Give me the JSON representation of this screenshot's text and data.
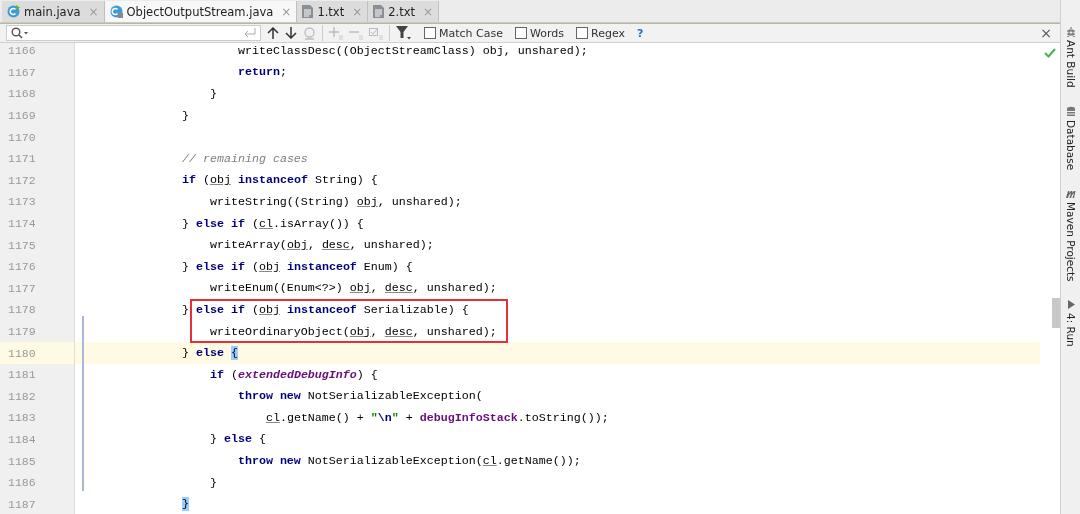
{
  "tabs": [
    {
      "label": "main.java",
      "kind": "java",
      "selected": false,
      "close": "×"
    },
    {
      "label": "ObjectOutputStream.java",
      "kind": "javalock",
      "selected": true,
      "close": "×"
    },
    {
      "label": "1.txt",
      "kind": "text",
      "selected": false,
      "close": "×"
    },
    {
      "label": "2.txt",
      "kind": "text",
      "selected": false,
      "close": "×"
    }
  ],
  "find_bar": {
    "options": [
      {
        "label": "Match Case",
        "checked": false
      },
      {
        "label": "Words",
        "checked": false
      },
      {
        "label": "Regex",
        "checked": false
      }
    ],
    "help": "?",
    "close": "×"
  },
  "editor": {
    "lines": [
      {
        "number": "1166",
        "segments": [
          {
            "text": "                    writeClassDesc((ObjectStreamClass) obj, unshared);",
            "kind": "plain"
          }
        ]
      },
      {
        "number": "1167",
        "segments": [
          {
            "text": "                    return",
            "kind": "kw"
          },
          {
            "text": ";",
            "kind": "plain"
          }
        ]
      },
      {
        "number": "1168",
        "segments": [
          {
            "text": "                }",
            "kind": "plain"
          }
        ]
      },
      {
        "number": "1169",
        "segments": [
          {
            "text": "            }",
            "kind": "plain"
          }
        ]
      },
      {
        "number": "1170"
      },
      {
        "number": "1171",
        "segments": [
          {
            "text": "            // remaining cases",
            "kind": "comment"
          }
        ]
      },
      {
        "number": "1172",
        "segments": [
          {
            "text": "            if",
            "kind": "kw"
          },
          {
            "text": " (",
            "kind": "plain"
          },
          {
            "text": "obj",
            "kind": "var"
          },
          {
            "text": " instanceof",
            "kind": "kw"
          },
          {
            "text": " String) {",
            "kind": "plain"
          }
        ]
      },
      {
        "number": "1173",
        "segments": [
          {
            "text": "                writeString((String) ",
            "kind": "plain"
          },
          {
            "text": "obj",
            "kind": "var"
          },
          {
            "text": ", unshared);",
            "kind": "plain"
          }
        ]
      },
      {
        "number": "1174",
        "segments": [
          {
            "text": "            } ",
            "kind": "plain"
          },
          {
            "text": "else if",
            "kind": "kw"
          },
          {
            "text": " (",
            "kind": "plain"
          },
          {
            "text": "cl",
            "kind": "var"
          },
          {
            "text": ".isArray()) {",
            "kind": "plain"
          }
        ]
      },
      {
        "number": "1175",
        "segments": [
          {
            "text": "                writeArray(",
            "kind": "plain"
          },
          {
            "text": "obj",
            "kind": "var"
          },
          {
            "text": ", ",
            "kind": "plain"
          },
          {
            "text": "desc",
            "kind": "var"
          },
          {
            "text": ", unshared);",
            "kind": "plain"
          }
        ]
      },
      {
        "number": "1176",
        "segments": [
          {
            "text": "            } ",
            "kind": "plain"
          },
          {
            "text": "else if",
            "kind": "kw"
          },
          {
            "text": " (",
            "kind": "plain"
          },
          {
            "text": "obj",
            "kind": "var"
          },
          {
            "text": " instanceof",
            "kind": "kw"
          },
          {
            "text": " Enum) {",
            "kind": "plain"
          }
        ]
      },
      {
        "number": "1177",
        "segments": [
          {
            "text": "                writeEnum((Enum<?>) ",
            "kind": "plain"
          },
          {
            "text": "obj",
            "kind": "var"
          },
          {
            "text": ", ",
            "kind": "plain"
          },
          {
            "text": "desc",
            "kind": "var"
          },
          {
            "text": ", unshared);",
            "kind": "plain"
          }
        ]
      },
      {
        "number": "1178",
        "segments": [
          {
            "text": "            } ",
            "kind": "plain"
          },
          {
            "text": "else if",
            "kind": "kw"
          },
          {
            "text": " (",
            "kind": "plain"
          },
          {
            "text": "obj",
            "kind": "var"
          },
          {
            "text": " instanceof",
            "kind": "kw"
          },
          {
            "text": " Serializable) {",
            "kind": "plain"
          }
        ]
      },
      {
        "number": "1179",
        "segments": [
          {
            "text": "                writeOrdinaryObject(",
            "kind": "plain"
          },
          {
            "text": "obj",
            "kind": "var"
          },
          {
            "text": ", ",
            "kind": "plain"
          },
          {
            "text": "desc",
            "kind": "var"
          },
          {
            "text": ", unshared);",
            "kind": "plain"
          }
        ]
      },
      {
        "number": "1180",
        "current": true,
        "segments": [
          {
            "text": "            } ",
            "kind": "plain"
          },
          {
            "text": "else ",
            "kind": "kw"
          },
          {
            "text": "{",
            "kind": "brace"
          }
        ]
      },
      {
        "number": "1181",
        "segments": [
          {
            "text": "                if",
            "kind": "kw"
          },
          {
            "text": " (",
            "kind": "plain"
          },
          {
            "text": "extendedDebugInfo",
            "kind": "static"
          },
          {
            "text": ") {",
            "kind": "plain"
          }
        ]
      },
      {
        "number": "1182",
        "segments": [
          {
            "text": "                    throw new",
            "kind": "kw"
          },
          {
            "text": " NotSerializableException(",
            "kind": "plain"
          }
        ]
      },
      {
        "number": "1183",
        "segments": [
          {
            "text": "                        cl",
            "kind": "var"
          },
          {
            "text": ".getName() + ",
            "kind": "plain"
          },
          {
            "text": "\"",
            "kind": "str"
          },
          {
            "text": "\\n",
            "kind": "esc"
          },
          {
            "text": "\"",
            "kind": "str"
          },
          {
            "text": " + ",
            "kind": "plain"
          },
          {
            "text": "debugInfoStack",
            "kind": "field"
          },
          {
            "text": ".toString());",
            "kind": "plain"
          }
        ]
      },
      {
        "number": "1184",
        "segments": [
          {
            "text": "                } ",
            "kind": "plain"
          },
          {
            "text": "else",
            "kind": "kw"
          },
          {
            "text": " {",
            "kind": "plain"
          }
        ]
      },
      {
        "number": "1185",
        "segments": [
          {
            "text": "                    throw new",
            "kind": "kw"
          },
          {
            "text": " NotSerializableException(",
            "kind": "plain"
          },
          {
            "text": "cl",
            "kind": "var"
          },
          {
            "text": ".getName());",
            "kind": "plain"
          }
        ]
      },
      {
        "number": "1186",
        "segments": [
          {
            "text": "                }",
            "kind": "plain"
          }
        ]
      },
      {
        "number": "1187",
        "segments": [
          {
            "text": "            }",
            "kind": "brace"
          }
        ]
      }
    ]
  },
  "tool_windows": [
    {
      "label": "Ant Build",
      "kind": "ant"
    },
    {
      "label": "Database",
      "kind": "db"
    },
    {
      "label": "Maven Projects",
      "kind": "maven"
    },
    {
      "label": "4: Run",
      "kind": "run"
    }
  ]
}
